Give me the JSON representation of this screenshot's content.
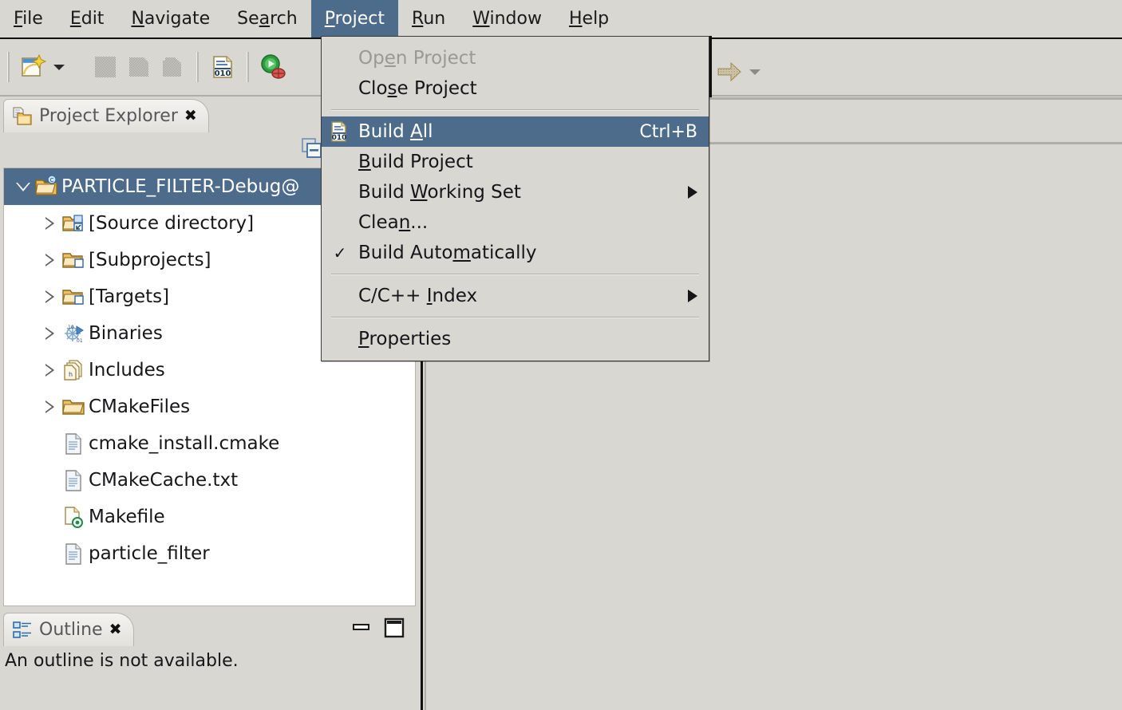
{
  "menubar": {
    "items": [
      {
        "label": "File",
        "mnemonic": "F",
        "active": false
      },
      {
        "label": "Edit",
        "mnemonic": "E",
        "active": false
      },
      {
        "label": "Navigate",
        "mnemonic": "N",
        "active": false
      },
      {
        "label": "Search",
        "mnemonic": "a",
        "active": false
      },
      {
        "label": "Project",
        "mnemonic": "P",
        "active": true
      },
      {
        "label": "Run",
        "mnemonic": "R",
        "active": false
      },
      {
        "label": "Window",
        "mnemonic": "W",
        "active": false
      },
      {
        "label": "Help",
        "mnemonic": "H",
        "active": false
      }
    ]
  },
  "toolbar": {
    "buttons": [
      {
        "name": "new-wizard-icon",
        "title": "New"
      },
      {
        "name": "new-dropdown-caret-icon",
        "title": "New menu"
      },
      {
        "name": "save-icon",
        "title": "Save"
      },
      {
        "name": "save-as-icon",
        "title": "Save As"
      },
      {
        "name": "save-all-icon",
        "title": "Save All"
      },
      {
        "name": "build-all-icon",
        "title": "Build All"
      },
      {
        "name": "run-debug-icon",
        "title": "Debug"
      },
      {
        "name": "forward-arrow-icon",
        "title": "Forward"
      },
      {
        "name": "forward-dropdown-caret-icon",
        "title": "Forward menu"
      }
    ]
  },
  "project_explorer": {
    "tab_title": "Project Explorer",
    "pin_glyph": "✖",
    "collapse_all_title": "Collapse All",
    "tree": [
      {
        "label": "PARTICLE_FILTER-Debug@",
        "icon": "c-project-icon",
        "twisty": "down",
        "depth": 0,
        "selected": true
      },
      {
        "label": "[Source directory]",
        "icon": "source-directory-icon",
        "twisty": "right",
        "depth": 1,
        "selected": false
      },
      {
        "label": "[Subprojects]",
        "icon": "subprojects-folder-icon",
        "twisty": "right",
        "depth": 1,
        "selected": false
      },
      {
        "label": "[Targets]",
        "icon": "targets-folder-icon",
        "twisty": "right",
        "depth": 1,
        "selected": false
      },
      {
        "label": "Binaries",
        "icon": "binaries-icon",
        "twisty": "right",
        "depth": 1,
        "selected": false
      },
      {
        "label": "Includes",
        "icon": "includes-icon",
        "twisty": "right",
        "depth": 1,
        "selected": false
      },
      {
        "label": "CMakeFiles",
        "icon": "folder-icon",
        "twisty": "right",
        "depth": 1,
        "selected": false
      },
      {
        "label": "cmake_install.cmake",
        "icon": "file-icon",
        "twisty": "none",
        "depth": 1,
        "selected": false
      },
      {
        "label": "CMakeCache.txt",
        "icon": "file-text-icon",
        "twisty": "none",
        "depth": 1,
        "selected": false
      },
      {
        "label": "Makefile",
        "icon": "makefile-icon",
        "twisty": "none",
        "depth": 1,
        "selected": false
      },
      {
        "label": "particle_filter",
        "icon": "file-icon",
        "twisty": "none",
        "depth": 1,
        "selected": false
      }
    ]
  },
  "outline": {
    "tab_title": "Outline",
    "pin_glyph": "✖",
    "minimize_title": "Minimize",
    "maximize_title": "Maximize",
    "message": "An outline is not available."
  },
  "project_menu": {
    "items": [
      {
        "label": "Open Project",
        "mnemonic": "e",
        "type": "item",
        "disabled": true,
        "accel": "",
        "submenu": false,
        "checked": false,
        "icon": ""
      },
      {
        "label": "Close Project",
        "mnemonic": "s",
        "type": "item",
        "disabled": false,
        "accel": "",
        "submenu": false,
        "checked": false,
        "icon": ""
      },
      {
        "type": "separator"
      },
      {
        "label": "Build All",
        "mnemonic": "A",
        "type": "item",
        "disabled": false,
        "accel": "Ctrl+B",
        "submenu": false,
        "checked": false,
        "icon": "build-all-icon",
        "highlighted": true
      },
      {
        "label": "Build Project",
        "mnemonic": "B",
        "type": "item",
        "disabled": false,
        "accel": "",
        "submenu": false,
        "checked": false,
        "icon": ""
      },
      {
        "label": "Build Working Set",
        "mnemonic": "W",
        "type": "item",
        "disabled": false,
        "accel": "",
        "submenu": true,
        "checked": false,
        "icon": ""
      },
      {
        "label": "Clean...",
        "mnemonic": "n",
        "type": "item",
        "disabled": false,
        "accel": "",
        "submenu": false,
        "checked": false,
        "icon": ""
      },
      {
        "label": "Build Automatically",
        "mnemonic": "m",
        "type": "item",
        "disabled": false,
        "accel": "",
        "submenu": false,
        "checked": true,
        "icon": ""
      },
      {
        "type": "separator"
      },
      {
        "label": "C/C++ Index",
        "mnemonic": "I",
        "type": "item",
        "disabled": false,
        "accel": "",
        "submenu": true,
        "checked": false,
        "icon": ""
      },
      {
        "type": "separator"
      },
      {
        "label": "Properties",
        "mnemonic": "P",
        "type": "item",
        "disabled": false,
        "accel": "",
        "submenu": false,
        "checked": false,
        "icon": ""
      }
    ],
    "check_glyph": "✓"
  },
  "colors": {
    "window_bg": "#d8d7d2",
    "selection_blue": "#4d6b8a",
    "tree_bg": "#ffffff",
    "border": "#b6b5af",
    "menu_border": "#3a3a3a",
    "disabled_text": "#9a9a95"
  }
}
